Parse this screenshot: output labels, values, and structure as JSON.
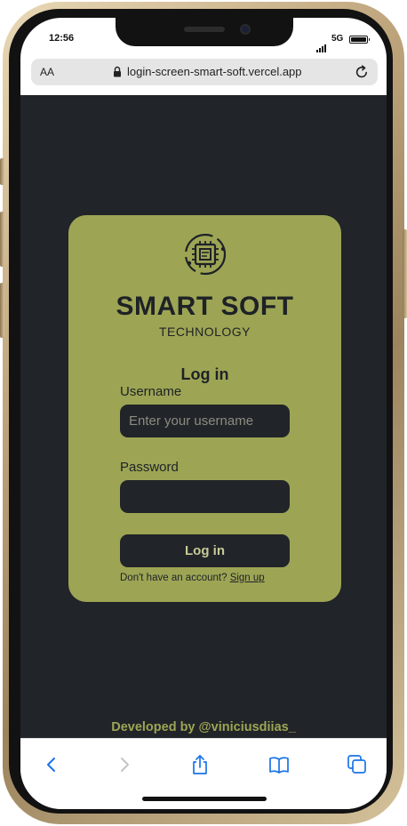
{
  "status_bar": {
    "time": "12:56",
    "network": "5G"
  },
  "browser": {
    "text_size_label": "AA",
    "url": "login-screen-smart-soft.vercel.app"
  },
  "app": {
    "brand_name": "SMART SOFT",
    "tagline": "TECHNOLOGY",
    "form_title": "Log in",
    "username_label": "Username",
    "username_placeholder": "Enter your username",
    "password_label": "Password",
    "submit_label": "Log in",
    "signup_prompt": "Don't have an account?",
    "signup_link": "Sign up",
    "footer_credit": "Developed by @viniciusdiias_"
  },
  "colors": {
    "page_background": "#212428",
    "card_background": "#9da555",
    "input_background": "#212428",
    "accent": "#9da555",
    "toolbar_icon": "#1a73e8"
  },
  "icons": [
    "cpu-chip-icon",
    "lock-icon",
    "reload-icon",
    "back-icon",
    "forward-icon",
    "share-icon",
    "bookmarks-icon",
    "tabs-icon"
  ]
}
